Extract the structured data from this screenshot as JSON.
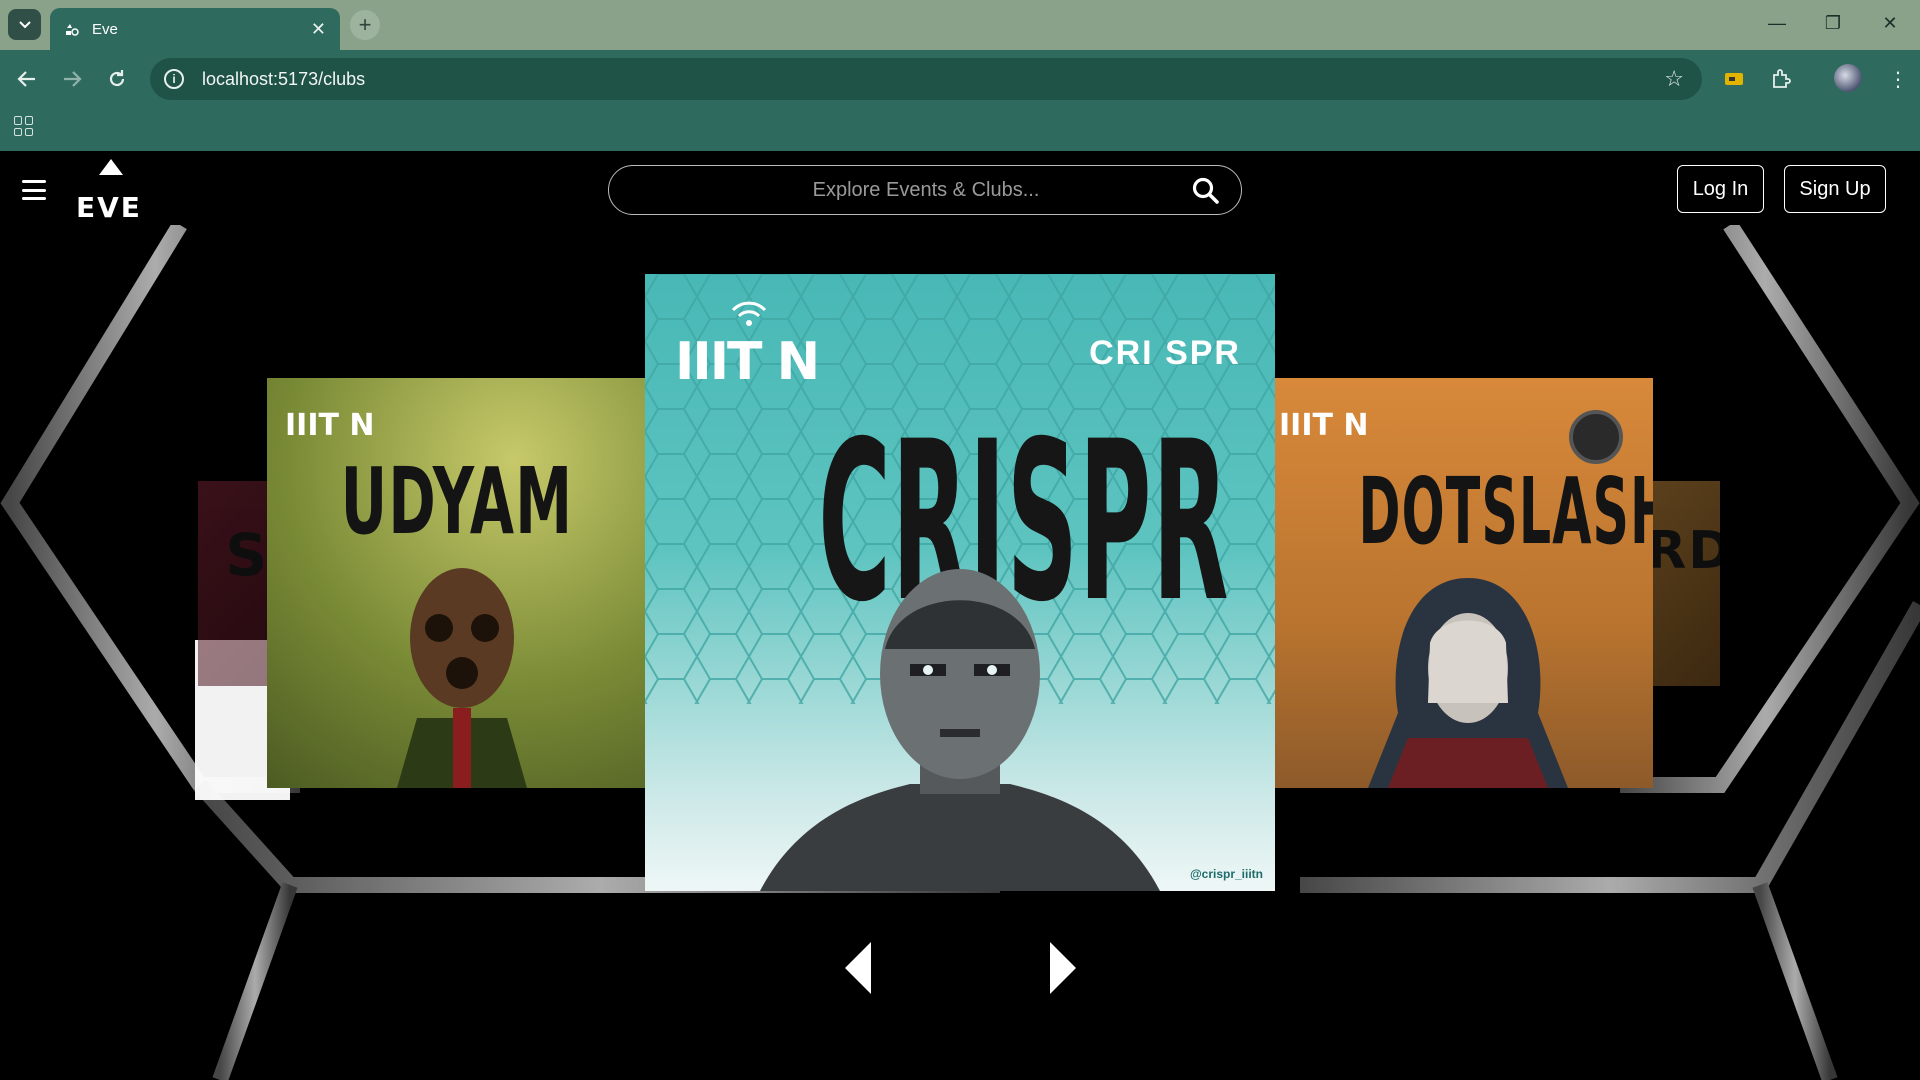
{
  "browser": {
    "tab_title": "Eve",
    "url": "localhost:5173/clubs",
    "new_tab_icon": "plus-icon",
    "window_controls": [
      "minimize-icon",
      "restore-icon",
      "close-icon"
    ]
  },
  "site": {
    "logo_text": "EVE",
    "search_placeholder": "Explore Events & Clubs...",
    "login_label": "Log In",
    "signup_label": "Sign Up"
  },
  "carousel": {
    "center": {
      "title": "CRISPR",
      "badge": "CRI SPR",
      "handle": "@crispr_iiitn",
      "accent": "#5ec4c0"
    },
    "left": {
      "title": "UDYAM",
      "accent": "#7f8a3a"
    },
    "right": {
      "title": "DOTSLASH",
      "accent": "#d6893a"
    },
    "far_left": {
      "title": "ST",
      "accent": "#8a2a3a"
    },
    "far_right": {
      "title": "ORDO",
      "accent": "#c18b3a"
    },
    "college_mark": "IIIT N"
  }
}
